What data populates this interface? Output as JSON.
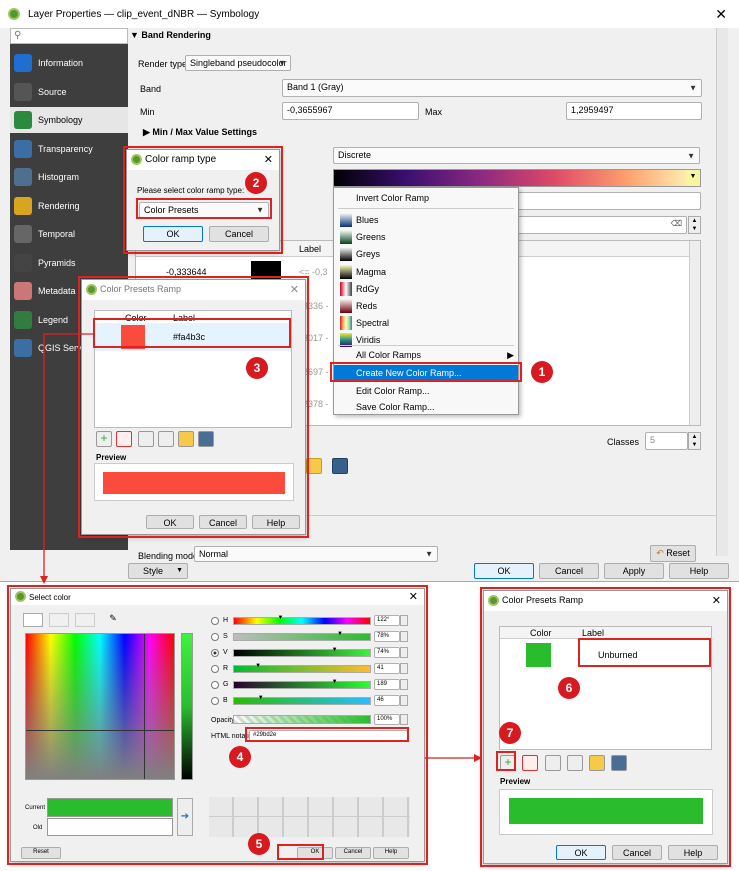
{
  "main": {
    "title": "Layer Properties — clip_event_dNBR — Symbology",
    "search_placeholder": "",
    "sidebar": [
      {
        "label": "Information",
        "icon": "information-icon"
      },
      {
        "label": "Source",
        "icon": "source-icon"
      },
      {
        "label": "Symbology",
        "icon": "symbology-icon"
      },
      {
        "label": "Transparency",
        "icon": "transparency-icon"
      },
      {
        "label": "Histogram",
        "icon": "histogram-icon"
      },
      {
        "label": "Rendering",
        "icon": "rendering-icon"
      },
      {
        "label": "Temporal",
        "icon": "temporal-icon"
      },
      {
        "label": "Pyramids",
        "icon": "pyramids-icon"
      },
      {
        "label": "Metadata",
        "icon": "metadata-icon"
      },
      {
        "label": "Legend",
        "icon": "legend-icon"
      },
      {
        "label": "QGIS Server",
        "icon": "qgis-server-icon"
      }
    ],
    "band_rendering": "Band Rendering",
    "render_type_label": "Render type",
    "render_type_value": "Singleband pseudocolor",
    "band_label": "Band",
    "band_value": "Band 1 (Gray)",
    "min_label": "Min",
    "min_value": "-0,3655967",
    "max_label": "Max",
    "max_value": "1,2959497",
    "minmax_settings": "Min / Max Value Settings",
    "interpolation_value": "Discrete",
    "label_header": "Label",
    "table_values": [
      "-0,333644",
      "3336 -",
      "3017 -",
      "2697 -",
      "2378 -"
    ],
    "first_label": "<= -0,3",
    "classes_label": "Classes",
    "classes_value": "5",
    "blending_label": "Blending mode",
    "blending_value": "Normal",
    "reset_label": "Reset",
    "style_label": "Style",
    "ok": "OK",
    "cancel": "Cancel",
    "apply": "Apply",
    "help": "Help"
  },
  "ramp_menu": {
    "invert": "Invert Color Ramp",
    "items": [
      "Blues",
      "Greens",
      "Greys",
      "Magma",
      "RdGy",
      "Reds",
      "Spectral",
      "Viridis"
    ],
    "all": "All Color Ramps",
    "create": "Create New Color Ramp...",
    "edit": "Edit Color Ramp...",
    "save": "Save Color Ramp..."
  },
  "ramp_type_dialog": {
    "title": "Color ramp type",
    "prompt": "Please select color ramp type:",
    "value": "Color Presets",
    "ok": "OK",
    "cancel": "Cancel"
  },
  "presets_small": {
    "title": "Color Presets Ramp",
    "col_color": "Color",
    "col_label": "Label",
    "row_label": "#fa4b3c",
    "row_color": "#fa4b3c",
    "preview": "Preview",
    "ok": "OK",
    "cancel": "Cancel",
    "help": "Help"
  },
  "select_color": {
    "title": "Select color",
    "sliders": [
      {
        "key": "H",
        "value": "122°"
      },
      {
        "key": "S",
        "value": "78%"
      },
      {
        "key": "V",
        "value": "74%"
      },
      {
        "key": "R",
        "value": "41"
      },
      {
        "key": "G",
        "value": "189"
      },
      {
        "key": "B",
        "value": "46"
      }
    ],
    "opacity_label": "Opacity",
    "opacity_value": "100%",
    "html_label": "HTML notation",
    "html_value": "#29bd2e",
    "current_label": "Current",
    "old_label": "Old",
    "current_color": "#29bd2e",
    "reset": "Reset",
    "ok": "OK",
    "cancel": "Cancel",
    "help": "Help"
  },
  "presets_large": {
    "title": "Color Presets Ramp",
    "col_color": "Color",
    "col_label": "Label",
    "row_label": "Unburned",
    "row_color": "#29bd2e",
    "preview": "Preview",
    "ok": "OK",
    "cancel": "Cancel",
    "help": "Help"
  },
  "badges": [
    "1",
    "2",
    "3",
    "4",
    "5",
    "6",
    "7"
  ]
}
